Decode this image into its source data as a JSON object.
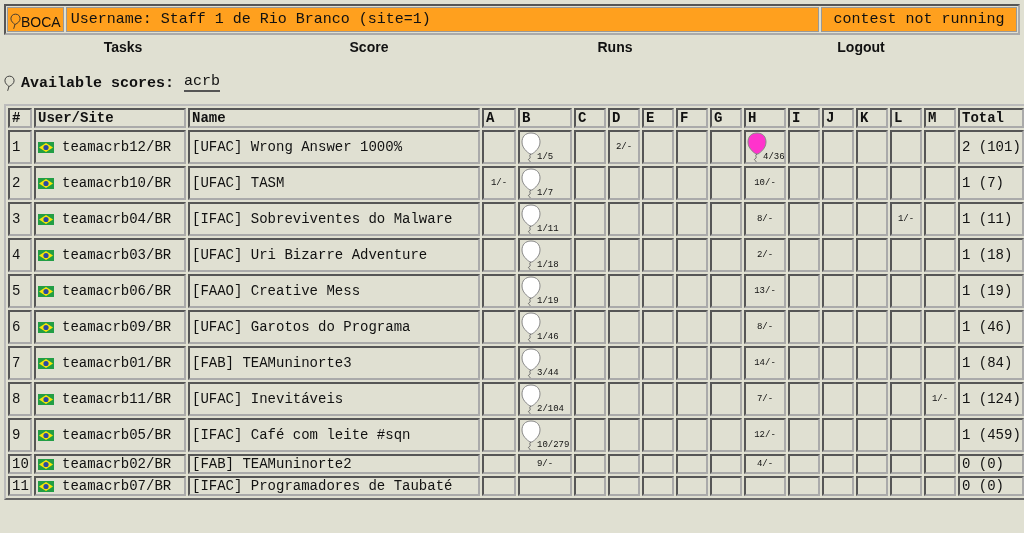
{
  "header": {
    "logo": "BOCA",
    "user": "Username: Staff 1 de Rio Branco (site=1)",
    "status": "contest not running"
  },
  "nav": [
    "Tasks",
    "Score",
    "Runs",
    "Logout"
  ],
  "scores": {
    "label": "Available scores:",
    "link": "acrb"
  },
  "table": {
    "columns": [
      "#",
      "User/Site",
      "Name",
      "A",
      "B",
      "C",
      "D",
      "E",
      "F",
      "G",
      "H",
      "I",
      "J",
      "K",
      "L",
      "M",
      "Total"
    ],
    "rows": [
      {
        "rank": "1",
        "user": "teamacrb12/BR",
        "name": "[UFAC] Wrong Answer 1000%",
        "total": "2 (101)",
        "results": [
          {
            "kind": "empty"
          },
          {
            "kind": "solved",
            "text": "1/5",
            "color": "#ffffff"
          },
          {
            "kind": "empty"
          },
          {
            "kind": "tried",
            "text": "2/-"
          },
          {
            "kind": "empty"
          },
          {
            "kind": "empty"
          },
          {
            "kind": "empty"
          },
          {
            "kind": "solved",
            "text": "4/36",
            "color": "#ff33cc"
          },
          {
            "kind": "empty"
          },
          {
            "kind": "empty"
          },
          {
            "kind": "empty"
          },
          {
            "kind": "empty"
          },
          {
            "kind": "empty"
          }
        ]
      },
      {
        "rank": "2",
        "user": "teamacrb10/BR",
        "name": "[UFAC] TASM",
        "total": "1 (7)",
        "results": [
          {
            "kind": "tried",
            "text": "1/-"
          },
          {
            "kind": "solved",
            "text": "1/7",
            "color": "#ffffff"
          },
          {
            "kind": "empty"
          },
          {
            "kind": "empty"
          },
          {
            "kind": "empty"
          },
          {
            "kind": "empty"
          },
          {
            "kind": "empty"
          },
          {
            "kind": "tried",
            "text": "10/-"
          },
          {
            "kind": "empty"
          },
          {
            "kind": "empty"
          },
          {
            "kind": "empty"
          },
          {
            "kind": "empty"
          },
          {
            "kind": "empty"
          }
        ]
      },
      {
        "rank": "3",
        "user": "teamacrb04/BR",
        "name": "[IFAC] Sobreviventes do Malware",
        "total": "1 (11)",
        "results": [
          {
            "kind": "empty"
          },
          {
            "kind": "solved",
            "text": "1/11",
            "color": "#ffffff"
          },
          {
            "kind": "empty"
          },
          {
            "kind": "empty"
          },
          {
            "kind": "empty"
          },
          {
            "kind": "empty"
          },
          {
            "kind": "empty"
          },
          {
            "kind": "tried",
            "text": "8/-"
          },
          {
            "kind": "empty"
          },
          {
            "kind": "empty"
          },
          {
            "kind": "empty"
          },
          {
            "kind": "tried",
            "text": "1/-"
          },
          {
            "kind": "empty"
          }
        ]
      },
      {
        "rank": "4",
        "user": "teamacrb03/BR",
        "name": "[UFAC] Uri Bizarre Adventure",
        "total": "1 (18)",
        "results": [
          {
            "kind": "empty"
          },
          {
            "kind": "solved",
            "text": "1/18",
            "color": "#ffffff"
          },
          {
            "kind": "empty"
          },
          {
            "kind": "empty"
          },
          {
            "kind": "empty"
          },
          {
            "kind": "empty"
          },
          {
            "kind": "empty"
          },
          {
            "kind": "tried",
            "text": "2/-"
          },
          {
            "kind": "empty"
          },
          {
            "kind": "empty"
          },
          {
            "kind": "empty"
          },
          {
            "kind": "empty"
          },
          {
            "kind": "empty"
          }
        ]
      },
      {
        "rank": "5",
        "user": "teamacrb06/BR",
        "name": "[FAAO] Creative Mess",
        "total": "1 (19)",
        "results": [
          {
            "kind": "empty"
          },
          {
            "kind": "solved",
            "text": "1/19",
            "color": "#ffffff"
          },
          {
            "kind": "empty"
          },
          {
            "kind": "empty"
          },
          {
            "kind": "empty"
          },
          {
            "kind": "empty"
          },
          {
            "kind": "empty"
          },
          {
            "kind": "tried",
            "text": "13/-"
          },
          {
            "kind": "empty"
          },
          {
            "kind": "empty"
          },
          {
            "kind": "empty"
          },
          {
            "kind": "empty"
          },
          {
            "kind": "empty"
          }
        ]
      },
      {
        "rank": "6",
        "user": "teamacrb09/BR",
        "name": "[UFAC] Garotos do Programa",
        "total": "1 (46)",
        "results": [
          {
            "kind": "empty"
          },
          {
            "kind": "solved",
            "text": "1/46",
            "color": "#ffffff"
          },
          {
            "kind": "empty"
          },
          {
            "kind": "empty"
          },
          {
            "kind": "empty"
          },
          {
            "kind": "empty"
          },
          {
            "kind": "empty"
          },
          {
            "kind": "tried",
            "text": "8/-"
          },
          {
            "kind": "empty"
          },
          {
            "kind": "empty"
          },
          {
            "kind": "empty"
          },
          {
            "kind": "empty"
          },
          {
            "kind": "empty"
          }
        ]
      },
      {
        "rank": "7",
        "user": "teamacrb01/BR",
        "name": "[FAB] TEAMuninorte3",
        "total": "1 (84)",
        "results": [
          {
            "kind": "empty"
          },
          {
            "kind": "solved",
            "text": "3/44",
            "color": "#ffffff"
          },
          {
            "kind": "empty"
          },
          {
            "kind": "empty"
          },
          {
            "kind": "empty"
          },
          {
            "kind": "empty"
          },
          {
            "kind": "empty"
          },
          {
            "kind": "tried",
            "text": "14/-"
          },
          {
            "kind": "empty"
          },
          {
            "kind": "empty"
          },
          {
            "kind": "empty"
          },
          {
            "kind": "empty"
          },
          {
            "kind": "empty"
          }
        ]
      },
      {
        "rank": "8",
        "user": "teamacrb11/BR",
        "name": "[UFAC] Inevitáveis",
        "total": "1 (124)",
        "results": [
          {
            "kind": "empty"
          },
          {
            "kind": "solved",
            "text": "2/104",
            "color": "#ffffff"
          },
          {
            "kind": "empty"
          },
          {
            "kind": "empty"
          },
          {
            "kind": "empty"
          },
          {
            "kind": "empty"
          },
          {
            "kind": "empty"
          },
          {
            "kind": "tried",
            "text": "7/-"
          },
          {
            "kind": "empty"
          },
          {
            "kind": "empty"
          },
          {
            "kind": "empty"
          },
          {
            "kind": "empty"
          },
          {
            "kind": "tried",
            "text": "1/-"
          }
        ]
      },
      {
        "rank": "9",
        "user": "teamacrb05/BR",
        "name": "[IFAC] Café com leite #sqn",
        "total": "1 (459)",
        "results": [
          {
            "kind": "empty"
          },
          {
            "kind": "solved",
            "text": "10/279",
            "color": "#ffffff"
          },
          {
            "kind": "empty"
          },
          {
            "kind": "empty"
          },
          {
            "kind": "empty"
          },
          {
            "kind": "empty"
          },
          {
            "kind": "empty"
          },
          {
            "kind": "tried",
            "text": "12/-"
          },
          {
            "kind": "empty"
          },
          {
            "kind": "empty"
          },
          {
            "kind": "empty"
          },
          {
            "kind": "empty"
          },
          {
            "kind": "empty"
          }
        ]
      },
      {
        "rank": "10",
        "user": "teamacrb02/BR",
        "name": "[FAB] TEAMuninorte2",
        "total": "0 (0)",
        "results": [
          {
            "kind": "empty"
          },
          {
            "kind": "tried",
            "text": "9/-"
          },
          {
            "kind": "empty"
          },
          {
            "kind": "empty"
          },
          {
            "kind": "empty"
          },
          {
            "kind": "empty"
          },
          {
            "kind": "empty"
          },
          {
            "kind": "tried",
            "text": "4/-"
          },
          {
            "kind": "empty"
          },
          {
            "kind": "empty"
          },
          {
            "kind": "empty"
          },
          {
            "kind": "empty"
          },
          {
            "kind": "empty"
          }
        ]
      },
      {
        "rank": "11",
        "user": "teamacrb07/BR",
        "name": "[IFAC] Programadores de Taubaté",
        "total": "0 (0)",
        "results": [
          {
            "kind": "empty"
          },
          {
            "kind": "empty"
          },
          {
            "kind": "empty"
          },
          {
            "kind": "empty"
          },
          {
            "kind": "empty"
          },
          {
            "kind": "empty"
          },
          {
            "kind": "empty"
          },
          {
            "kind": "empty"
          },
          {
            "kind": "empty"
          },
          {
            "kind": "empty"
          },
          {
            "kind": "empty"
          },
          {
            "kind": "empty"
          },
          {
            "kind": "empty"
          }
        ]
      }
    ]
  }
}
